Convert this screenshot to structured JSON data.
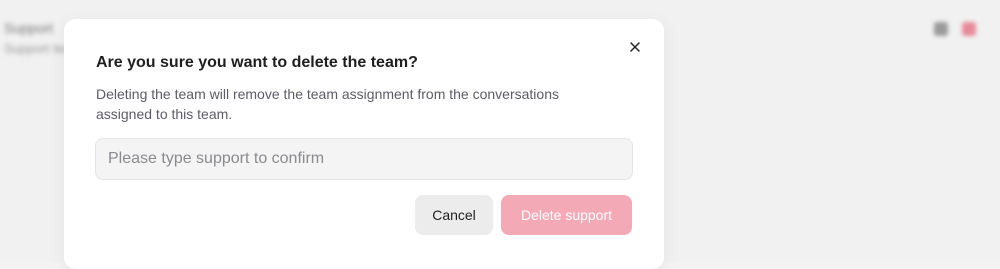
{
  "background": {
    "title": "Support",
    "subtitle": "Support team members",
    "icons": [
      "gear-icon",
      "trash-icon"
    ]
  },
  "dialog": {
    "title": "Are you sure you want to delete the team?",
    "description": "Deleting the team will remove the team assignment from the conversations assigned to this team.",
    "input_placeholder": "Please type support to confirm",
    "input_value": "",
    "cancel_label": "Cancel",
    "delete_label": "Delete support",
    "close_icon": "close-icon"
  },
  "colors": {
    "delete_button_bg": "#f4a9b6",
    "cancel_button_bg": "#ececec",
    "backdrop": "#f1f1f1"
  }
}
